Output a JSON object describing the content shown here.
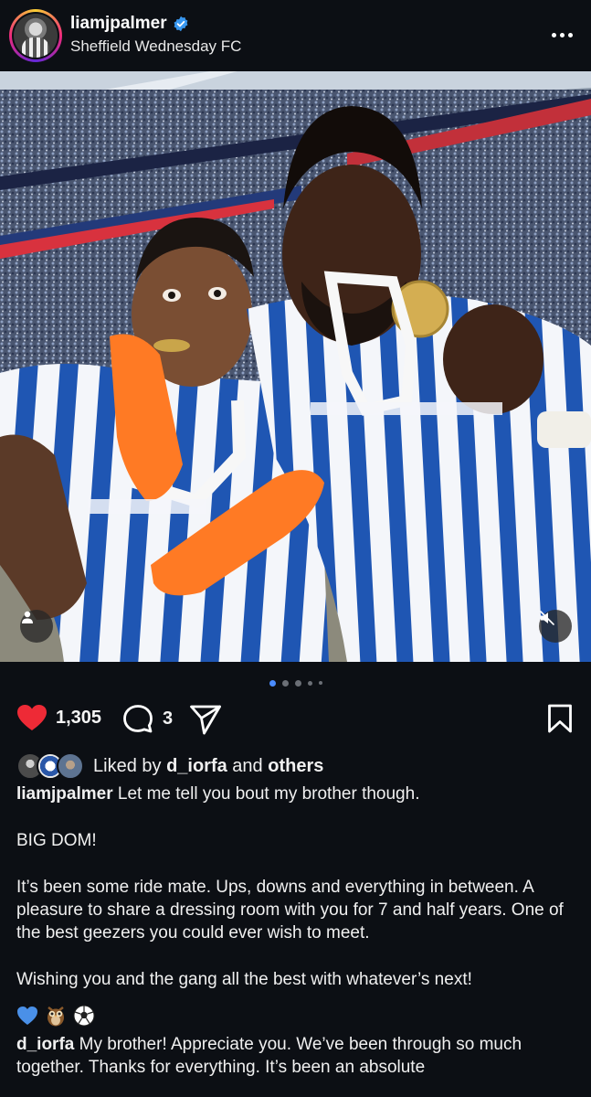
{
  "header": {
    "username": "liamjpalmer",
    "subtitle": "Sheffield Wednesday FC"
  },
  "post": {
    "carousel_dots": 5,
    "active_dot": 0
  },
  "actions": {
    "likes_count": "1,305",
    "comments_count": "3"
  },
  "liked_by": {
    "prefix": "Liked by ",
    "user": "d_iorfa",
    "middle": " and ",
    "others": "others"
  },
  "caption": {
    "username": "liamjpalmer",
    "line1": " Let me tell you bout my brother though.",
    "para2": "BIG DOM!",
    "para3": "It’s been some ride mate. Ups, downs and everything in between. A pleasure to share a dressing room with you for 7 and half years. One of the best geezers you could ever wish to meet.",
    "para4": "Wishing you and the gang all the best with whatever’s next!"
  },
  "comment": {
    "username": "d_iorfa",
    "text": " My brother! Appreciate you. We’ve been through so much together. Thanks for everything. It’s been an absolute"
  },
  "colors": {
    "like_heart": "#ee2a36",
    "verified": "#3897f0",
    "active_dot": "#4a8cff"
  }
}
